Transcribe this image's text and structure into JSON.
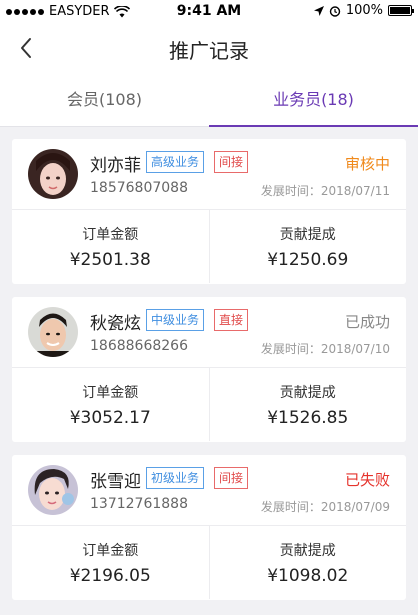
{
  "status_bar": {
    "carrier": "EASYDER",
    "time": "9:41 AM",
    "battery": "100%"
  },
  "header": {
    "title": "推广记录"
  },
  "tabs": [
    {
      "label": "会员(108)",
      "active": false
    },
    {
      "label": "业务员(18)",
      "active": true
    }
  ],
  "colors": {
    "accent": "#6a3ab4",
    "pending": "#f08a1c",
    "success": "#888888",
    "failed": "#e5332c"
  },
  "records": [
    {
      "name": "刘亦菲",
      "level": "高级业务",
      "type": "间接",
      "status": "审核中",
      "phone": "18576807088",
      "date": "发展时间：2018/07/11",
      "order_label": "订单金额",
      "order_amount": "¥2501.38",
      "commission_label": "贡献提成",
      "commission_amount": "¥1250.69"
    },
    {
      "name": "秋瓷炫",
      "level": "中级业务",
      "type": "直接",
      "status": "已成功",
      "phone": "18688668266",
      "date": "发展时间：2018/07/10",
      "order_label": "订单金额",
      "order_amount": "¥3052.17",
      "commission_label": "贡献提成",
      "commission_amount": "¥1526.85"
    },
    {
      "name": "张雪迎",
      "level": "初级业务",
      "type": "间接",
      "status": "已失败",
      "phone": "13712761888",
      "date": "发展时间：2018/07/09",
      "order_label": "订单金额",
      "order_amount": "¥2196.05",
      "commission_label": "贡献提成",
      "commission_amount": "¥1098.02"
    }
  ]
}
